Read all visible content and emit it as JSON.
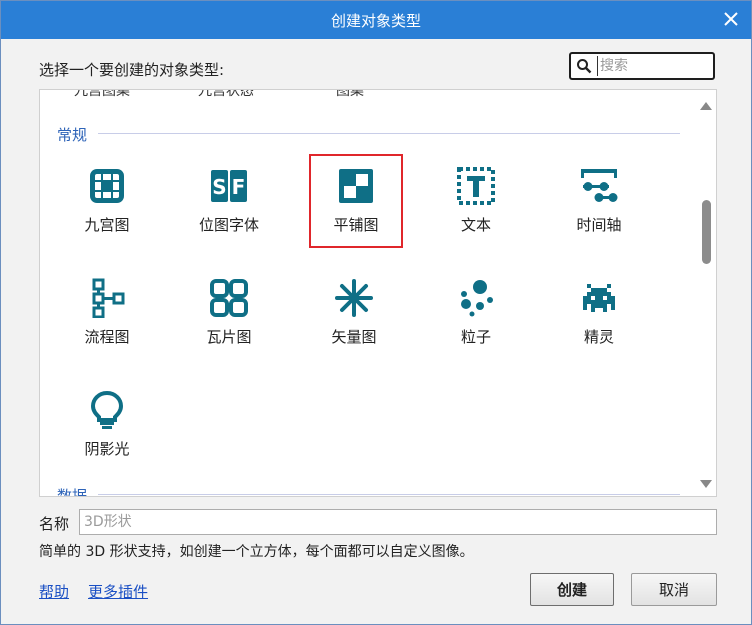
{
  "window": {
    "title": "创建对象类型"
  },
  "prompt": "选择一个要创建的对象类型:",
  "search": {
    "placeholder": "搜索",
    "value": ""
  },
  "partial_row": [
    "九宫图集",
    "九宫状态",
    "图集"
  ],
  "sections": [
    {
      "title": "常规",
      "items": [
        {
          "label": "九宫图",
          "icon": "nine-patch-icon"
        },
        {
          "label": "位图字体",
          "icon": "bitmap-font-icon"
        },
        {
          "label": "平铺图",
          "icon": "tiled-background-icon",
          "selected": true
        },
        {
          "label": "文本",
          "icon": "text-icon"
        },
        {
          "label": "时间轴",
          "icon": "timeline-icon"
        },
        {
          "label": "流程图",
          "icon": "flowchart-icon"
        },
        {
          "label": "瓦片图",
          "icon": "tilemap-icon"
        },
        {
          "label": "矢量图",
          "icon": "svg-icon"
        },
        {
          "label": "粒子",
          "icon": "particles-icon"
        },
        {
          "label": "精灵",
          "icon": "sprite-icon"
        },
        {
          "label": "阴影光",
          "icon": "shadow-light-icon"
        }
      ]
    },
    {
      "title": "数据"
    }
  ],
  "name_field": {
    "label": "名称",
    "placeholder": "3D形状",
    "value": ""
  },
  "description": "简单的 3D 形状支持，如创建一个立方体，每个面都可以自定义图像。",
  "links": {
    "help": "帮助",
    "more_plugins": "更多插件"
  },
  "buttons": {
    "create": "创建",
    "cancel": "取消"
  },
  "colors": {
    "titlebar": "#2a7fd6",
    "icon": "#0f6f86",
    "selection": "#e0262b",
    "section_title": "#2d63b8",
    "link": "#1a4fc4"
  }
}
